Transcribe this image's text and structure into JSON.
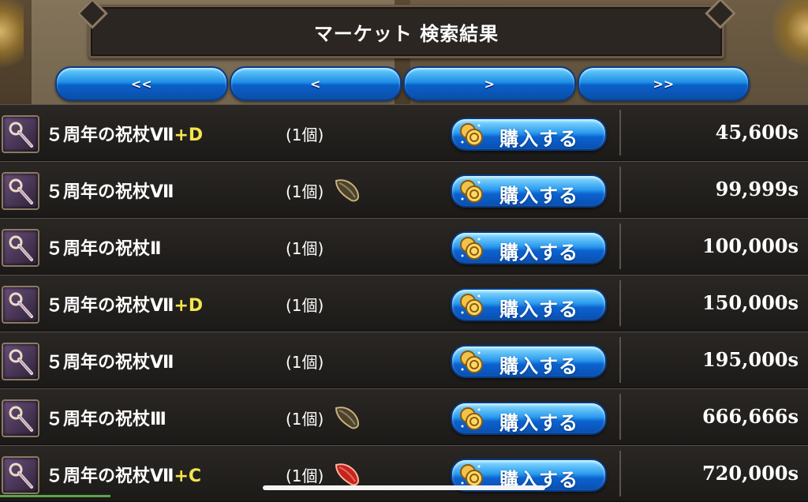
{
  "header": {
    "title": "マーケット 検索結果"
  },
  "nav": [
    {
      "label": "<<"
    },
    {
      "label": "<"
    },
    {
      "label": ">"
    },
    {
      "label": ">>"
    }
  ],
  "buy_label": "購入する",
  "rows": [
    {
      "name": "５周年の祝杖Ⅶ",
      "suffix": "+D",
      "qty": "(1個)",
      "badge": "none",
      "price": "45,600s"
    },
    {
      "name": "５周年の祝杖Ⅶ",
      "suffix": "",
      "qty": "(1個)",
      "badge": "dark-seed-icon",
      "price": "99,999s"
    },
    {
      "name": "５周年の祝杖Ⅱ",
      "suffix": "",
      "qty": "(1個)",
      "badge": "none",
      "price": "100,000s"
    },
    {
      "name": "５周年の祝杖Ⅶ",
      "suffix": "+D",
      "qty": "(1個)",
      "badge": "none",
      "price": "150,000s"
    },
    {
      "name": "５周年の祝杖Ⅶ",
      "suffix": "",
      "qty": "(1個)",
      "badge": "none",
      "price": "195,000s"
    },
    {
      "name": "５周年の祝杖Ⅲ",
      "suffix": "",
      "qty": "(1個)",
      "badge": "dark-seed-icon",
      "price": "666,666s"
    },
    {
      "name": "５周年の祝杖Ⅶ",
      "suffix": "+C",
      "qty": "(1個)",
      "badge": "red-seed-icon",
      "price": "720,000s"
    }
  ],
  "colors": {
    "accent_blue": "#1f8fe6",
    "suffix_yellow": "#f4e54b",
    "row_bg": "#1c1a18"
  }
}
